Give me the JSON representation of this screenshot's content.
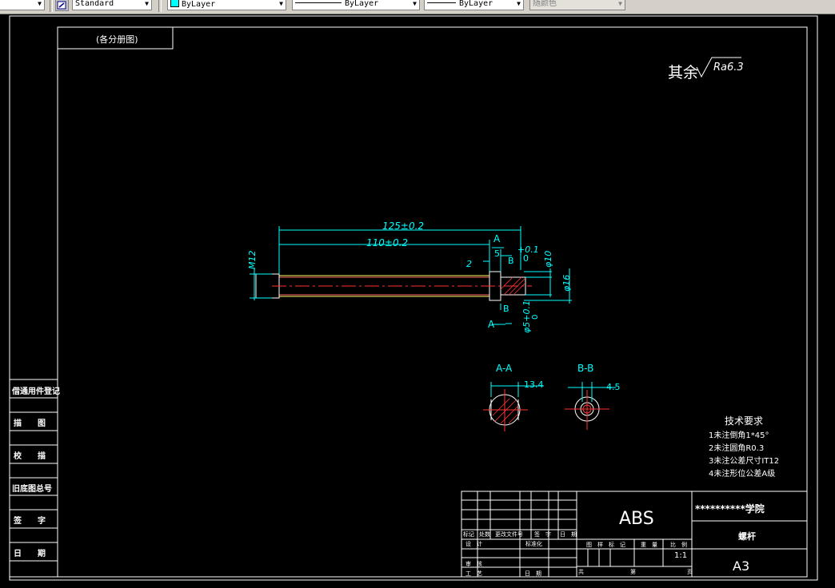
{
  "toolbar": {
    "text_style": "Standard",
    "layer_color_label": "ByLayer",
    "layer_color_hex": "#00ffff",
    "linetype": "ByLayer",
    "lineweight": "ByLayer",
    "plot_style": "随颜色"
  },
  "drawing": {
    "corner_label": "(各分册图)",
    "roughness_prefix": "其余",
    "roughness_value": "Ra6.3",
    "dims": {
      "len_125": "125±0.2",
      "len_110": "110±0.2",
      "dim_5": "5",
      "dim_2": "2",
      "tol_top": "+0.1",
      "tol_zero": "0",
      "d10": "φ10",
      "d16": "φ16",
      "m12": "M12",
      "tol_bottom": "φ5+0.1",
      "tol_bottom_zero": "0",
      "section_a": "A",
      "section_a2": "A",
      "section_b": "B",
      "section_b2": "B"
    },
    "sections": {
      "aa_title": "A-A",
      "aa_dim": "13.4",
      "bb_title": "B-B",
      "bb_dim": "4.5"
    },
    "tech_req": {
      "title": "技术要求",
      "items": [
        "1未注倒角1*45°",
        "2未注圆角R0.3",
        "3未注公差尺寸IT12",
        "4未注形位公差A级"
      ]
    },
    "left_table": [
      "借通用件登记",
      "描　　图",
      "校　　描",
      "旧底图总号",
      "签　　字",
      "日　　期"
    ],
    "title_block": {
      "code": "ABS",
      "school": "**********学院",
      "part_name": "螺杆",
      "sheet_size": "A3",
      "scale": "1:1",
      "rev_headers": [
        "标记",
        "处数",
        "更改文件号",
        "签　字",
        "日　期"
      ],
      "row_design": "设　计",
      "row_std": "标准化",
      "row_review": "审　核",
      "row_process": "工　艺",
      "row_date": "日　期",
      "stage_headers": [
        "图　样　标　记",
        "重　量",
        "比　例"
      ],
      "sheet_total": "共",
      "sheet_num": "第",
      "sheet_unit": "页"
    }
  }
}
